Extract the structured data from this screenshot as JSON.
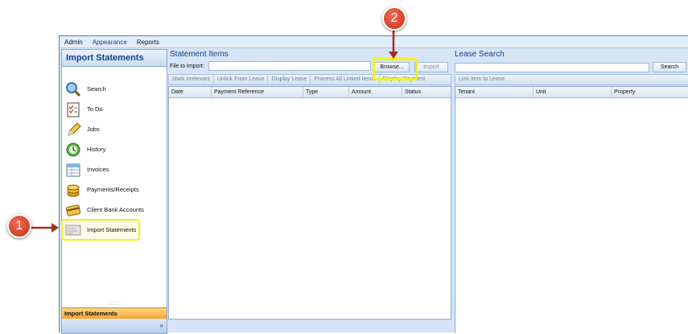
{
  "menubar": {
    "items": [
      "Admin",
      "Appearance",
      "Reports"
    ]
  },
  "sidebar": {
    "title": "Import Statements",
    "items": [
      {
        "label": "Search",
        "icon": "search-icon"
      },
      {
        "label": "To Do",
        "icon": "todo-icon"
      },
      {
        "label": "Jobs",
        "icon": "pencil-icon"
      },
      {
        "label": "History",
        "icon": "history-icon"
      },
      {
        "label": "Invoices",
        "icon": "invoices-icon"
      },
      {
        "label": "Payments/Receipts",
        "icon": "coins-icon"
      },
      {
        "label": "Client Bank Accounts",
        "icon": "card-icon"
      },
      {
        "label": "Import Statements",
        "icon": "import-icon"
      }
    ],
    "bottom_label": "Import Statements",
    "expand_glyph": "»",
    "grip": "::::::::::"
  },
  "statement": {
    "title": "Statement Items",
    "file_label": "File to Import:",
    "file_value": "",
    "browse_label": "Browse...",
    "import_label": "Import",
    "toolbar": [
      "Mark Irrelevant",
      "Unlink From Lease",
      "Display Lease",
      "Process All Linked Items",
      "Display Payment"
    ],
    "columns": [
      "Date",
      "Payment Reference",
      "Type",
      "Amount",
      "Status"
    ]
  },
  "lease": {
    "title": "Lease Search",
    "search_value": "",
    "search_label": "Search",
    "toolbar": [
      "Link Item to Lease"
    ],
    "columns": [
      "Tenant",
      "Unit",
      "Property"
    ]
  },
  "callouts": [
    "1",
    "2"
  ],
  "colors": {
    "highlight": "#f4f11a",
    "callout": "#d63b26",
    "accent": "#15428b"
  }
}
